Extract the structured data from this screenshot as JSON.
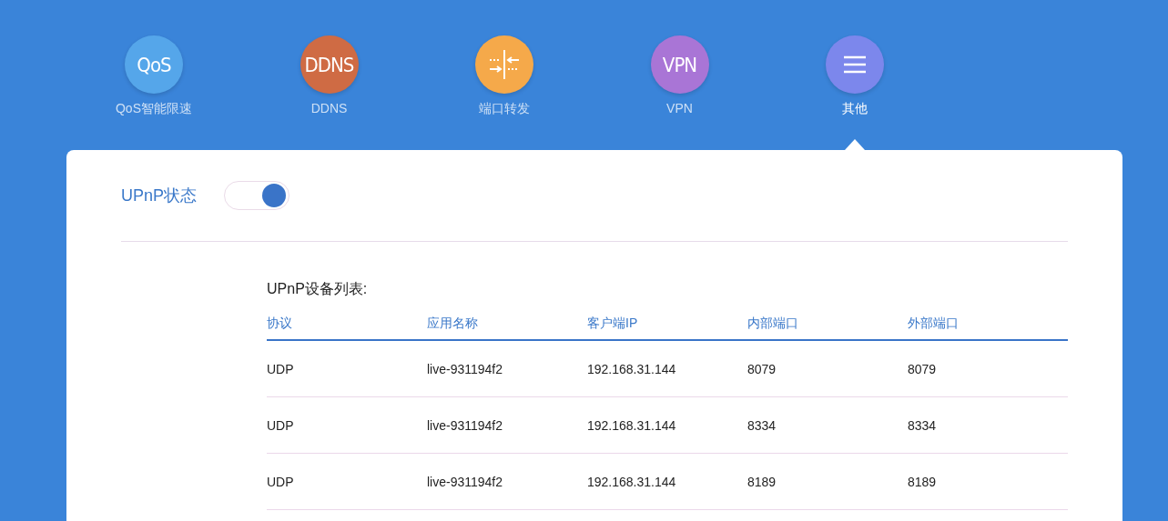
{
  "nav": [
    {
      "label": "QoS智能限速",
      "kind": "text",
      "icon_text": "QoS",
      "color": "#55a6ea",
      "selected": false
    },
    {
      "label": "DDNS",
      "kind": "text",
      "icon_text": "DDNS",
      "color": "#cf6b44",
      "selected": false
    },
    {
      "label": "端口转发",
      "kind": "ports",
      "color": "#f5a94a",
      "selected": false
    },
    {
      "label": "VPN",
      "kind": "text",
      "icon_text": "VPN",
      "color": "#a975d6",
      "selected": false
    },
    {
      "label": "其他",
      "kind": "menu",
      "color": "#7c87ec",
      "selected": true
    }
  ],
  "upnp": {
    "label": "UPnP状态",
    "on": true
  },
  "table": {
    "title": "UPnP设备列表:",
    "columns": [
      "协议",
      "应用名称",
      "客户端IP",
      "内部端口",
      "外部端口"
    ],
    "rows": [
      [
        "UDP",
        "live-931194f2",
        "192.168.31.144",
        "8079",
        "8079"
      ],
      [
        "UDP",
        "live-931194f2",
        "192.168.31.144",
        "8334",
        "8334"
      ],
      [
        "UDP",
        "live-931194f2",
        "192.168.31.144",
        "8189",
        "8189"
      ]
    ]
  }
}
